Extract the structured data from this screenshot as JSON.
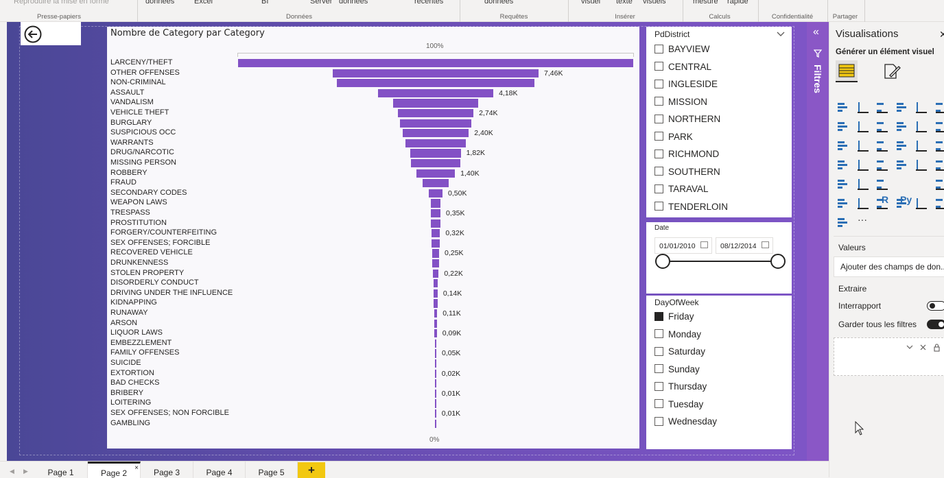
{
  "ribbon": {
    "top_items": [
      "Reproduire la mise en forme",
      "données",
      "Excel",
      "BI",
      "Server",
      "données",
      "récentes",
      "données",
      "visuel",
      "texte",
      "visuels",
      "mesure",
      "rapide"
    ],
    "groups": [
      "Presse-papiers",
      "Données",
      "Requêtes",
      "Insérer",
      "Calculs",
      "Confidentialité",
      "Partager"
    ]
  },
  "funnel": {
    "title": "Nombre de Category par Category",
    "pct_top": "100%",
    "pct_bottom": "0%",
    "bar_color": "#8351c5"
  },
  "chart_data": {
    "type": "bar",
    "title": "Nombre de Category par Category",
    "categories": [
      "LARCENY/THEFT",
      "OTHER OFFENSES",
      "NON-CRIMINAL",
      "ASSAULT",
      "VANDALISM",
      "VEHICLE THEFT",
      "BURGLARY",
      "SUSPICIOUS OCC",
      "WARRANTS",
      "DRUG/NARCOTIC",
      "MISSING PERSON",
      "ROBBERY",
      "FRAUD",
      "SECONDARY CODES",
      "WEAPON LAWS",
      "TRESPASS",
      "PROSTITUTION",
      "FORGERY/COUNTERFEITING",
      "SEX OFFENSES; FORCIBLE",
      "RECOVERED VEHICLE",
      "DRUNKENNESS",
      "STOLEN PROPERTY",
      "DISORDERLY CONDUCT",
      "DRIVING UNDER THE INFLUENCE",
      "KIDNAPPING",
      "RUNAWAY",
      "ARSON",
      "LIQUOR LAWS",
      "EMBEZZLEMENT",
      "FAMILY OFFENSES",
      "SUICIDE",
      "EXTORTION",
      "BAD CHECKS",
      "BRIBERY",
      "LOITERING",
      "SEX OFFENSES; NON FORCIBLE",
      "GAMBLING"
    ],
    "values": [
      14320,
      7460,
      7170,
      4180,
      3080,
      2740,
      2570,
      2400,
      2200,
      1820,
      1790,
      1400,
      960,
      500,
      360,
      350,
      340,
      320,
      300,
      250,
      235,
      220,
      150,
      140,
      125,
      110,
      100,
      90,
      65,
      50,
      35,
      20,
      15,
      10,
      10,
      10,
      5
    ],
    "value_labels": [
      "",
      "7,46K",
      "",
      "4,18K",
      "",
      "2,74K",
      "",
      "2,40K",
      "",
      "1,82K",
      "",
      "1,40K",
      "",
      "0,50K",
      "",
      "0,35K",
      "",
      "0,32K",
      "",
      "0,25K",
      "",
      "0,22K",
      "",
      "0,14K",
      "",
      "0,11K",
      "",
      "0,09K",
      "",
      "0,05K",
      "",
      "0,02K",
      "",
      "0,01K",
      "",
      "0,01K",
      ""
    ],
    "orientation": "funnel",
    "legend": "none",
    "grid": false
  },
  "district_slicer": {
    "title": "PdDistrict",
    "items": [
      "BAYVIEW",
      "CENTRAL",
      "INGLESIDE",
      "MISSION",
      "NORTHERN",
      "PARK",
      "RICHMOND",
      "SOUTHERN",
      "TARAVAL",
      "TENDERLOIN"
    ]
  },
  "date_slicer": {
    "title": "Date",
    "start": "01/01/2010",
    "end": "08/12/2014"
  },
  "day_slicer": {
    "title": "DayOfWeek",
    "items": [
      "Friday",
      "Monday",
      "Saturday",
      "Sunday",
      "Thursday",
      "Tuesday",
      "Wednesday"
    ],
    "checked": [
      "Friday"
    ]
  },
  "filters_pane": {
    "label": "Filtres"
  },
  "viz_pane": {
    "title": "Visualisations",
    "subtitle": "Générer un élément visuel",
    "values_label": "Valeurs",
    "add_fields": "Ajouter des champs de don...",
    "drill_label": "Extraire",
    "cross_report": "Interrapport",
    "keep_filters": "Garder tous les filtres",
    "r_label": "R",
    "py_label": "Py",
    "more": "···"
  },
  "tabs": {
    "pages": [
      "Page 1",
      "Page 2",
      "Page 3",
      "Page 4",
      "Page 5"
    ],
    "active": "Page 2",
    "close": "×",
    "add": "+"
  }
}
